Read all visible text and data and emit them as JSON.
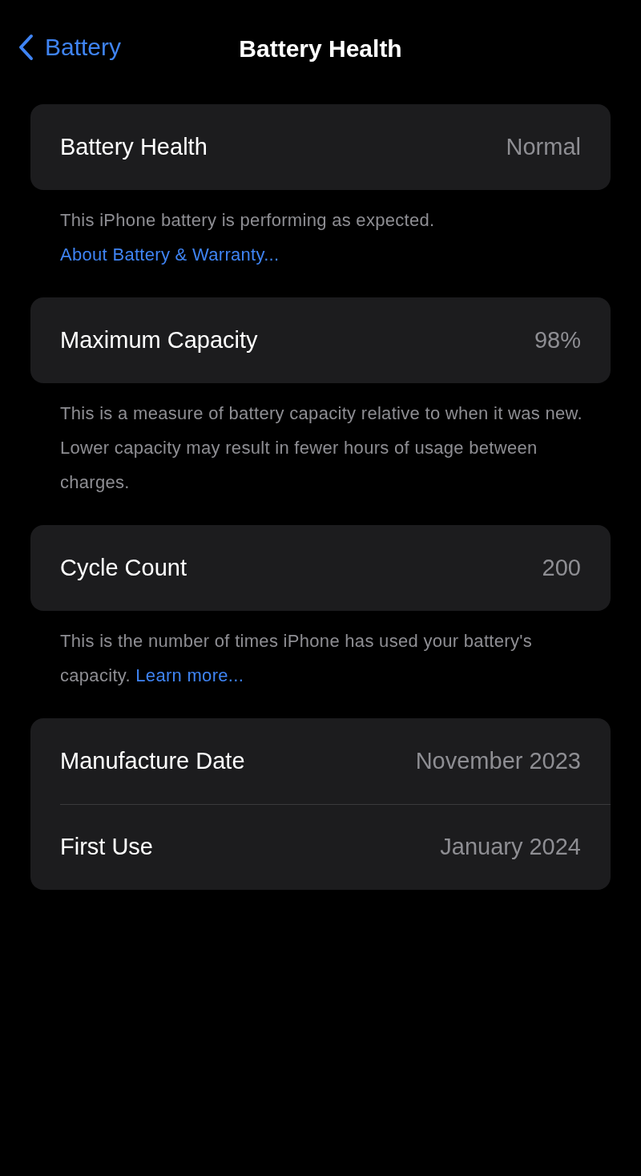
{
  "nav": {
    "back_label": "Battery",
    "title": "Battery Health"
  },
  "sections": [
    {
      "rows": [
        {
          "label": "Battery Health",
          "value": "Normal"
        }
      ],
      "footer": {
        "text": "This iPhone battery is performing as expected.",
        "link": "About Battery & Warranty..."
      }
    },
    {
      "rows": [
        {
          "label": "Maximum Capacity",
          "value": "98%"
        }
      ],
      "footer": {
        "text": "This is a measure of battery capacity relative to when it was new. Lower capacity may result in fewer hours of usage between charges."
      }
    },
    {
      "rows": [
        {
          "label": "Cycle Count",
          "value": "200"
        }
      ],
      "footer": {
        "text": "This is the number of times iPhone has used your battery's capacity.",
        "link": "Learn more..."
      }
    },
    {
      "rows": [
        {
          "label": "Manufacture Date",
          "value": "November 2023"
        },
        {
          "label": "First Use",
          "value": "January 2024"
        }
      ]
    }
  ]
}
